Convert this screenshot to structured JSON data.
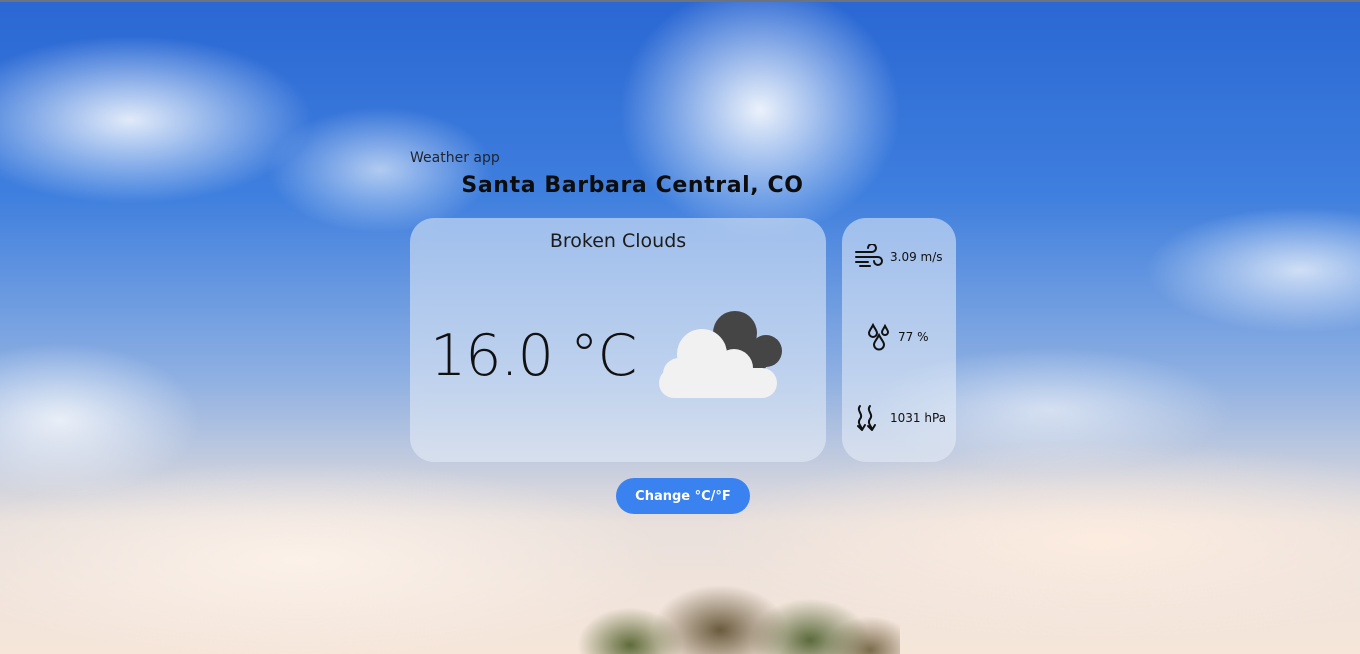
{
  "app": {
    "title": "Weather app"
  },
  "location": {
    "name": "Santa Barbara Central, CO"
  },
  "current": {
    "condition": "Broken Clouds",
    "temperature": "16.0 °C",
    "icon": "broken-clouds-icon"
  },
  "stats": {
    "wind": {
      "value": "3.09 m/s",
      "icon": "wind-icon"
    },
    "humidity": {
      "value": "77 %",
      "icon": "humidity-drops-icon"
    },
    "pressure": {
      "value": "1031 hPa",
      "icon": "pressure-arrows-icon"
    }
  },
  "controls": {
    "unit_toggle_label": "Change °C/°F"
  },
  "colors": {
    "button": "#3a82f0",
    "card": "rgba(232,238,248,0.55)",
    "dark_cloud": "#444444",
    "light_cloud": "#f2f2f2"
  }
}
